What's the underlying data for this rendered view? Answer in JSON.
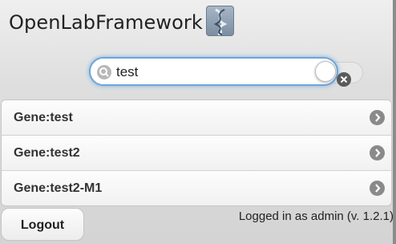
{
  "header": {
    "title": "OpenLabFramework",
    "logo_icon": "dna-helix-icon"
  },
  "search": {
    "value": "test",
    "icon": "search-icon",
    "clear_icon": "clear-icon"
  },
  "results": [
    {
      "label": "Gene:test",
      "icon": "chevron-right-icon"
    },
    {
      "label": "Gene:test2",
      "icon": "chevron-right-icon"
    },
    {
      "label": "Gene:test2-M1",
      "icon": "chevron-right-icon"
    }
  ],
  "footer": {
    "logout_label": "Logout",
    "status": "Logged in as admin (v. 1.2.1)"
  },
  "colors": {
    "search_focus": "#6ea6d8",
    "background": "#d8d8d8"
  }
}
